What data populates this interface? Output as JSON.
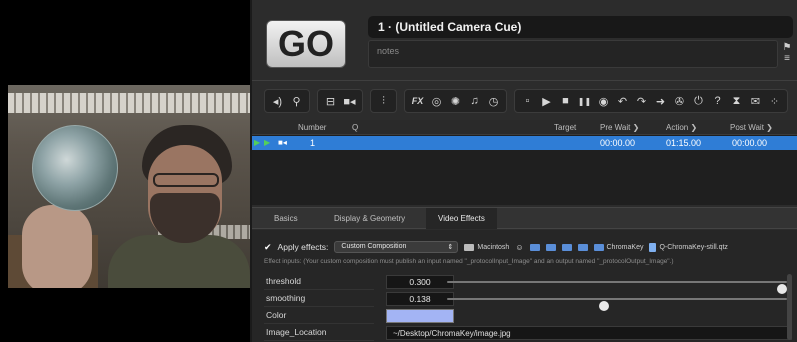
{
  "window": {
    "go_label": "GO",
    "cue_title": "1 · (Untitled Camera Cue)",
    "notes_placeholder": "notes"
  },
  "toolbar": {
    "groups": [
      [
        "speaker-icon",
        "mic-icon"
      ],
      [
        "screen-icon",
        "camera-icon"
      ],
      [
        "sliders-icon"
      ],
      [
        "fx-icon",
        "target-icon",
        "network-icon",
        "music-note-icon",
        "clock-icon"
      ],
      [
        "stop-square-icon",
        "play-icon",
        "stop-icon",
        "pause-icon",
        "record-icon",
        "undo-icon",
        "redo-icon",
        "arrow-icon",
        "gear-icon",
        "power-icon",
        "help-icon",
        "hourglass-icon",
        "chat-icon",
        "more-icon"
      ]
    ],
    "glyphs": {
      "speaker-icon": "◂)",
      "mic-icon": "⚲",
      "screen-icon": "⊟",
      "camera-icon": "■◂",
      "sliders-icon": "⫶",
      "fx-icon": "FX",
      "target-icon": "◎",
      "network-icon": "✺",
      "music-note-icon": "♫",
      "clock-icon": "◷",
      "stop-square-icon": "▫",
      "play-icon": "▶",
      "stop-icon": "■",
      "pause-icon": "❚❚",
      "record-icon": "◉",
      "undo-icon": "↶",
      "redo-icon": "↷",
      "arrow-icon": "➜",
      "gear-icon": "✇",
      "power-icon": "⏻",
      "help-icon": "?",
      "hourglass-icon": "⧗",
      "chat-icon": "✉",
      "more-icon": "⁘"
    }
  },
  "cue_list": {
    "headers": {
      "number": "Number",
      "q": "Q",
      "target": "Target",
      "pre_wait": "Pre Wait ❯",
      "action": "Action ❯",
      "post_wait": "Post Wait ❯"
    },
    "row": {
      "number": "1",
      "pre_wait": "00:00.00",
      "action": "01:15.00",
      "post_wait": "00:00.00"
    }
  },
  "tabs": [
    {
      "label": "Basics",
      "active": false
    },
    {
      "label": "Display & Geometry",
      "active": false
    },
    {
      "label": "Video Effects",
      "active": true
    }
  ],
  "effects": {
    "apply_label": "Apply effects:",
    "apply_value": "Custom Composition",
    "path_crumbs": [
      "Macintosh",
      "ChromaKey",
      "Q-ChromaKey-still.qtz"
    ],
    "inputs_note": "Effect inputs:  (Your custom composition must publish an input named \"_protocolInput_Image\" and an output named \"_protocolOutput_Image\".)",
    "params": [
      {
        "label": "threshold",
        "value": "0.300",
        "fraction": 1.0
      },
      {
        "label": "smoothing",
        "value": "0.138",
        "fraction": 0.46
      }
    ],
    "color_label": "Color",
    "color_value": "#a3b4f4",
    "image_location_label": "Image_Location",
    "image_location_value": "~/Desktop/ChromaKey/image.jpg"
  },
  "colors": {
    "selection": "#2f7dd6",
    "accent_green": "#53d05a"
  }
}
